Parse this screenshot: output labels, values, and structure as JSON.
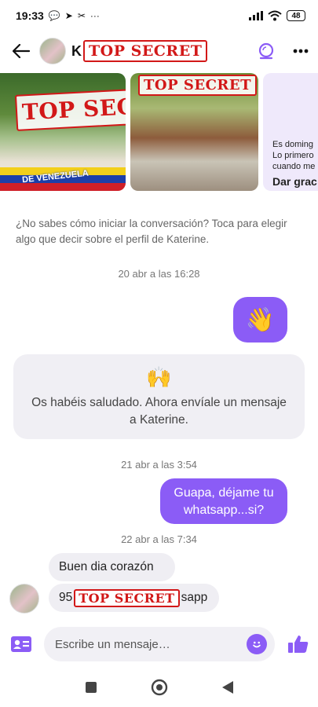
{
  "status_bar": {
    "time": "19:33",
    "battery": "48"
  },
  "header": {
    "name_visible_initial": "K",
    "redaction_label": "TOP SECRET"
  },
  "photos": [
    {
      "redaction_label": "TOP SECRET",
      "banner_text": "DE VENEZUELA"
    },
    {
      "redaction_label": "TOP SECRET"
    },
    {
      "line1": "Es doming",
      "line2": "Lo primero",
      "line3": "cuando me",
      "cta": "Dar grac"
    }
  ],
  "chat": {
    "suggestion": "¿No sabes cómo iniciar la conversación? Toca para elegir algo que decir sobre el perfil de Katerine.",
    "messages": [
      {
        "type": "timestamp",
        "text": "20 abr a las 16:28"
      },
      {
        "type": "outgoing",
        "text": "👋"
      },
      {
        "type": "system",
        "emoji": "🙌",
        "text": "Os habéis saludado. Ahora envíale un mensaje a Katerine."
      },
      {
        "type": "timestamp",
        "text": "21 abr a las 3:54"
      },
      {
        "type": "outgoing",
        "text": "Guapa, déjame tu whatsapp...si?"
      },
      {
        "type": "timestamp",
        "text": "22 abr a las 7:34"
      },
      {
        "type": "incoming",
        "text": "Buen dia corazón"
      },
      {
        "type": "incoming",
        "text_start": "95",
        "redaction_label": "TOP SECRET",
        "text_end": "sapp"
      }
    ]
  },
  "composer": {
    "placeholder": "Escribe un mensaje…"
  },
  "colors": {
    "accent": "#8b5cf6",
    "incoming_bubble": "#efeef3",
    "redaction": "#d21818"
  },
  "icons": {
    "back": "arrow-left-icon",
    "video": "video-call-icon",
    "more": "more-dots-icon",
    "contact_card": "contact-card-icon",
    "emoji": "emoji-icon",
    "like": "thumbs-up-icon",
    "nav_recent": "square-icon",
    "nav_home": "circle-icon",
    "nav_back": "triangle-back-icon"
  }
}
